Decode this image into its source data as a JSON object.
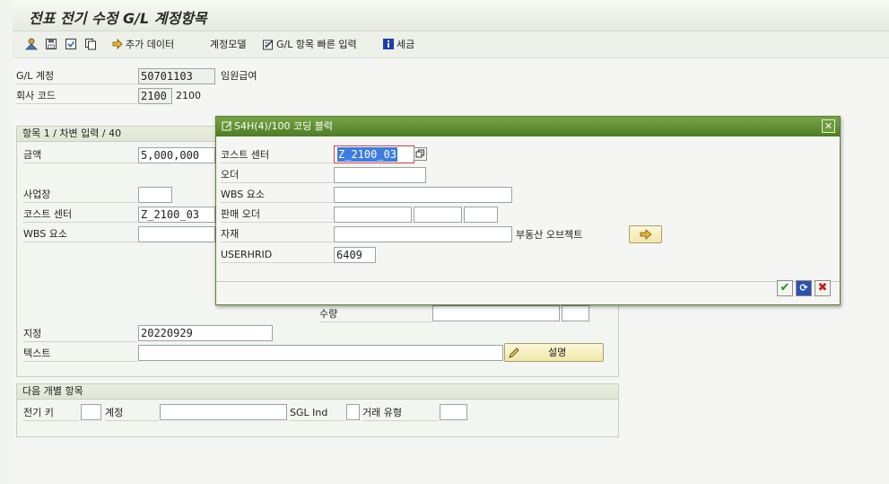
{
  "header": {
    "title": "전표 전기 수정 G/L 계정항목"
  },
  "toolbar": {
    "more_data": "추가 데이터",
    "account_model": "계정모델",
    "gl_fast_entry": "G/L 항목 빠른 입력",
    "tax": "세금"
  },
  "account": {
    "gl_label": "G/L 계정",
    "gl_value": "50701103",
    "gl_desc": "임원급여",
    "company_label": "회사 코드",
    "company_value": "2100",
    "company_desc": "2100"
  },
  "item": {
    "header": "항목 1 / 차변 입력 / 40",
    "amount_label": "금액",
    "amount_value": "5,000,000",
    "business_place_label": "사업장",
    "business_place_value": "",
    "cost_center_label": "코스트 센터",
    "cost_center_value": "Z_2100_03",
    "wbs_label": "WBS 요소",
    "wbs_value": "",
    "quantity_label": "수량",
    "assignment_label": "지정",
    "assignment_value": "20220929",
    "text_label": "텍스트",
    "text_value": "",
    "explain_button": "설명"
  },
  "next_item": {
    "header": "다음 개별 항목",
    "posting_key_label": "전기 키",
    "account_label": "계정",
    "sgl_label": "SGL Ind",
    "trans_type_label": "거래 유형"
  },
  "dialog": {
    "title": "S4H(4)/100 코딩 블럭",
    "cost_center_label": "코스트 센터",
    "cost_center_value": "Z_2100_03",
    "order_label": "오더",
    "wbs_label": "WBS 요소",
    "sales_order_label": "판매 오더",
    "material_label": "자재",
    "real_estate_label": "부동산 오브젝트",
    "userhrid_label": "USERHRID",
    "userhrid_value": "6409"
  }
}
